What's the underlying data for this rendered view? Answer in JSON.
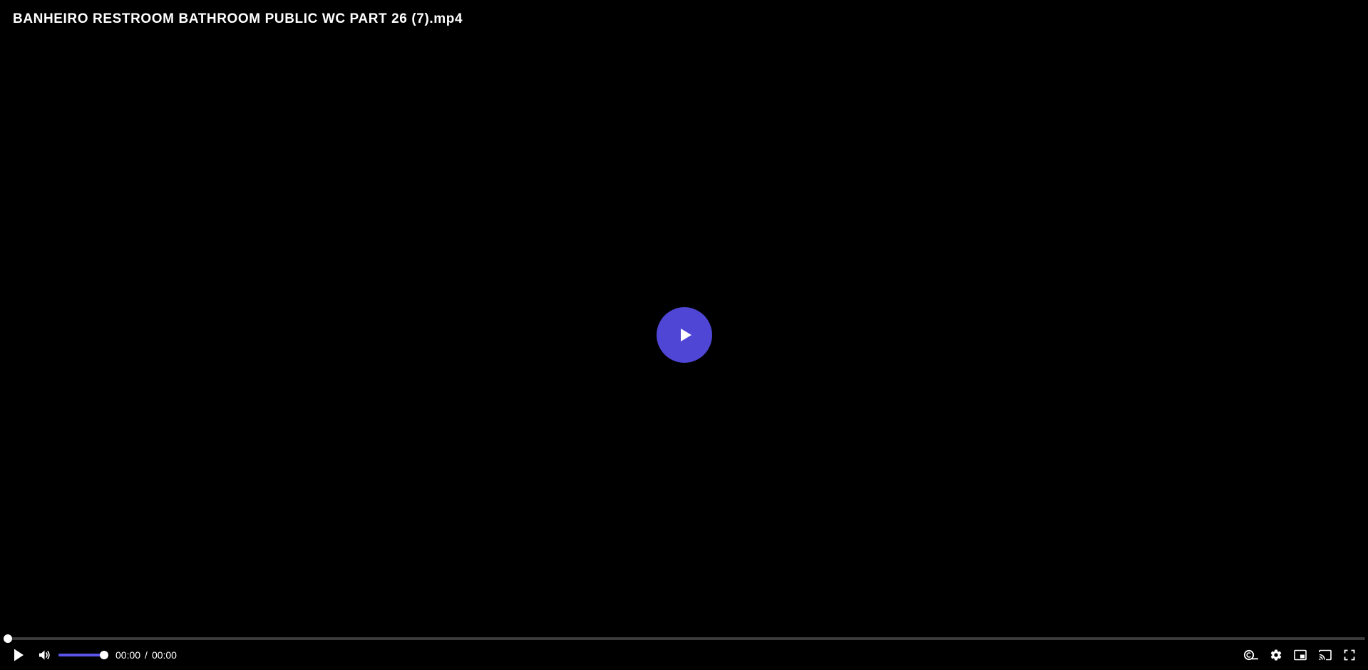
{
  "video": {
    "title": "BANHEIRO RESTROOM BATHROOM PUBLIC WC PART 26 (7).mp4"
  },
  "colors": {
    "accent": "#4f46d5",
    "background": "#000000",
    "track": "#3a3a3a",
    "text": "#ffffff"
  },
  "playback": {
    "progress": 0,
    "current_time": "00:00",
    "separator": "/",
    "duration": "00:00"
  },
  "volume": {
    "level": 1.0
  },
  "icons": {
    "big_play": "play-icon",
    "play": "play-icon",
    "volume": "volume-icon",
    "captions": "captions-icon",
    "settings": "gear-icon",
    "pip": "picture-in-picture-icon",
    "cast": "cast-icon",
    "fullscreen": "fullscreen-icon"
  }
}
